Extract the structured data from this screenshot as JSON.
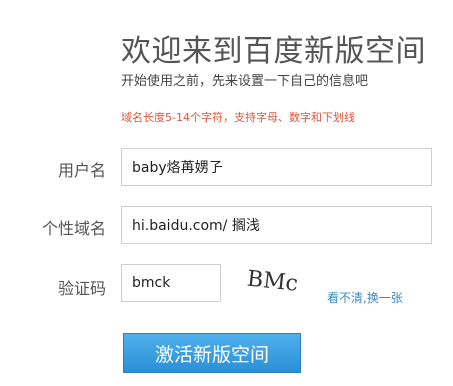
{
  "header": {
    "title": "欢迎来到百度新版空间",
    "subtitle": "开始使用之前，先来设置一下自己的信息吧",
    "hint": "域名长度5-14个字符，支持字母、数字和下划线"
  },
  "form": {
    "username": {
      "label": "用户名",
      "value": "baby烙苒娚孒"
    },
    "domain": {
      "label": "个性域名",
      "value": "hi.baidu.com/ 搁浅"
    },
    "captcha": {
      "label": "验证码",
      "value": "bmck",
      "image_text": "BMck",
      "refresh_label": "看不清,换一张"
    },
    "submit_label": "激活新版空间"
  },
  "colors": {
    "hint": "#e0553d",
    "link": "#3a8bc9",
    "button": "#3a9be2"
  }
}
